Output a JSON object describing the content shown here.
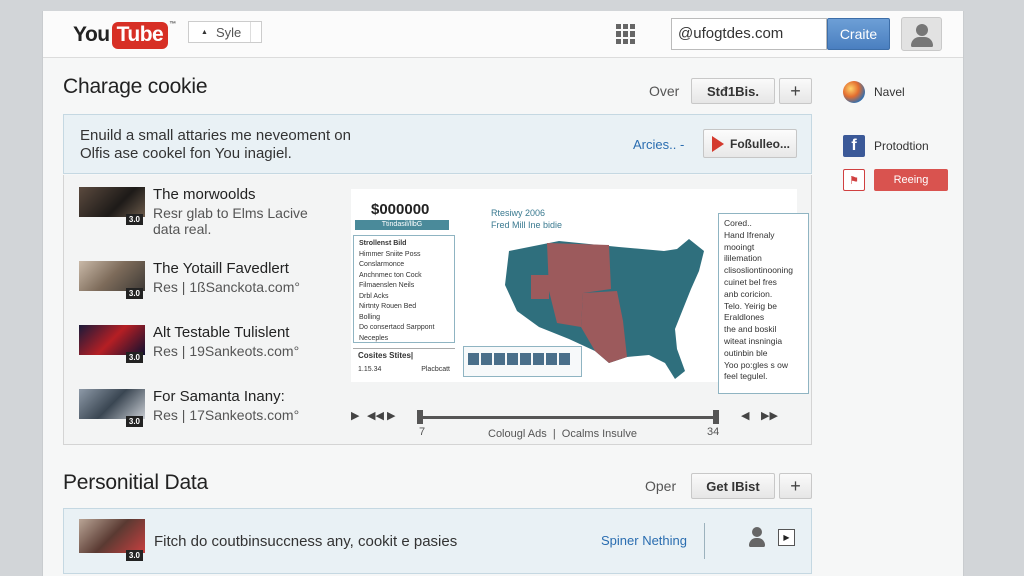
{
  "header": {
    "logo_you": "You",
    "logo_tube": "Tube",
    "style_select": "Syle",
    "search_value": "@ufogtdes.com",
    "create_label": "Craite"
  },
  "section1": {
    "title": "Charage cookie",
    "over_label": "Over",
    "action_label": "Stđ1Bis.",
    "plus_label": "+"
  },
  "notice": {
    "line1": "Enuild a small attaries me neveoment on",
    "line2": "Olfis ase cookel fon You inagiel.",
    "articles_label": "Arcies.. -",
    "follow_label": "Foßulleo..."
  },
  "videos": [
    {
      "title": "The morwoolds",
      "sub1": "Resr glab to Elms Lacive",
      "sub2": "data real.",
      "duration": "3.0"
    },
    {
      "title": "The Yotaill Favedlert",
      "sub1": "Res | 1ßSanckota.com°",
      "sub2": "",
      "duration": "3.0"
    },
    {
      "title": "Alt Testable Tulislent",
      "sub1": "Res | 19Sankeots.com°",
      "sub2": "",
      "duration": "3.0"
    },
    {
      "title": "For Samanta Inany:",
      "sub1": "Res | 17Sankeots.com°",
      "sub2": "",
      "duration": "3.0"
    }
  ],
  "chart": {
    "price": "$000000",
    "bar_label": "Ttindasil/llbG",
    "report_title_1": "Rtesiwy 2006",
    "report_title_2": "Fred Mill Ine bidie",
    "legend_header": "Strollenst Bild",
    "legend_items": [
      "Himmer Sniite Poss",
      "Conslarmonce",
      "Anchnmec ton Cock",
      "Filmaenslen Neils",
      "Drbl Acks",
      "Nirtnty Rouen Bed",
      "Bolling",
      "Do consertacd Sarppont",
      "Neceples"
    ],
    "legend_foot_title": "Cosites Stites|",
    "legend_foot_left": "1.15.34",
    "legend_foot_right": "Placbcatt",
    "side_note": "Cored..\nHand Ifrenaly\nmooingt\nililemation\nclisosliontinooning\ncuinet bel fres\nanb coricion.\nTelo. Yeirig be\nEraldlones\nthe and boskil\nwiteat insningia\noutinbin ble\nYoo po:gles s ow\nfeel tegulel."
  },
  "controls": {
    "num_left": "7",
    "num_right": "34",
    "middle_label": "Colougl Ads  |  Ocalms Insulve"
  },
  "section2": {
    "title": "Personitial Data",
    "over_label": "Oper",
    "action_label": "Get IBist",
    "plus_label": "+"
  },
  "pd_bar": {
    "text": "Fitch do coutbinsuccness any, cookit e pasies",
    "link": "Spiner Nething",
    "duration": "3.0"
  },
  "rail": {
    "item1": "Navel",
    "item2": "Protodtion",
    "item3_button": "Reeing"
  }
}
